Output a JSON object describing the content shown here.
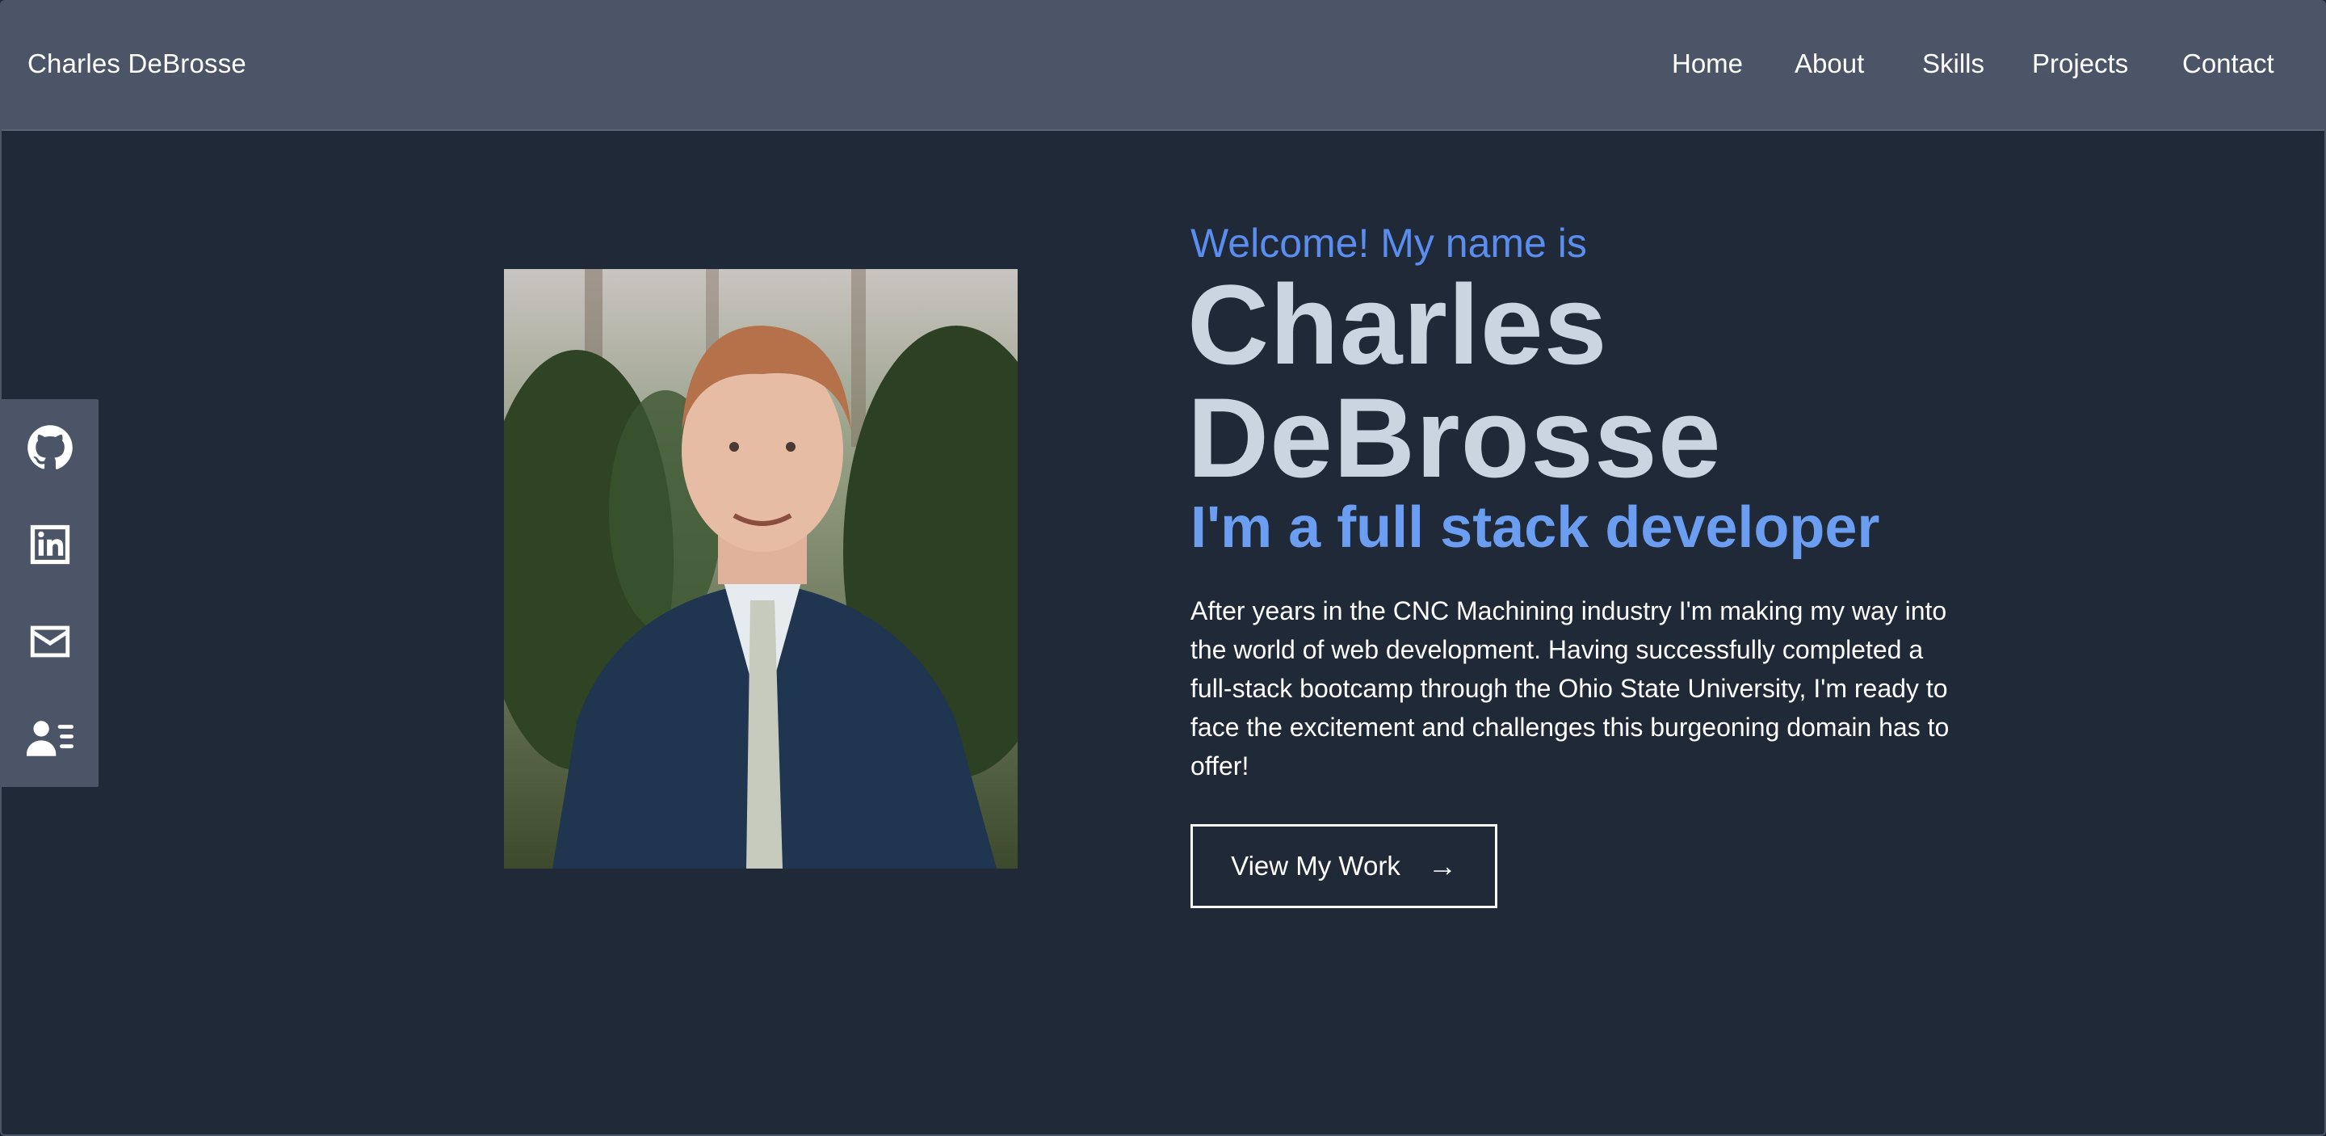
{
  "header": {
    "brand": "Charles DeBrosse",
    "nav": [
      "Home",
      "About",
      "Skills",
      "Projects",
      "Contact"
    ]
  },
  "social": {
    "icons": [
      "github-icon",
      "linkedin-icon",
      "email-icon",
      "resume-icon"
    ]
  },
  "hero": {
    "welcome": "Welcome! My name is",
    "name_line1": "Charles",
    "name_line2": "DeBrosse",
    "tagline": "I'm a full stack developer",
    "bio": "After years in the CNC Machining industry I'm making my way into the world of web development. Having successfully completed a full-stack bootcamp through the Ohio State University, I'm ready to face the excitement and challenges this burgeoning domain has to offer!",
    "cta_label": "View My Work",
    "cta_arrow": "→"
  },
  "colors": {
    "background": "#1f2937",
    "header": "#4b5567",
    "accent": "#5b8def",
    "name": "#cbd5e1"
  }
}
